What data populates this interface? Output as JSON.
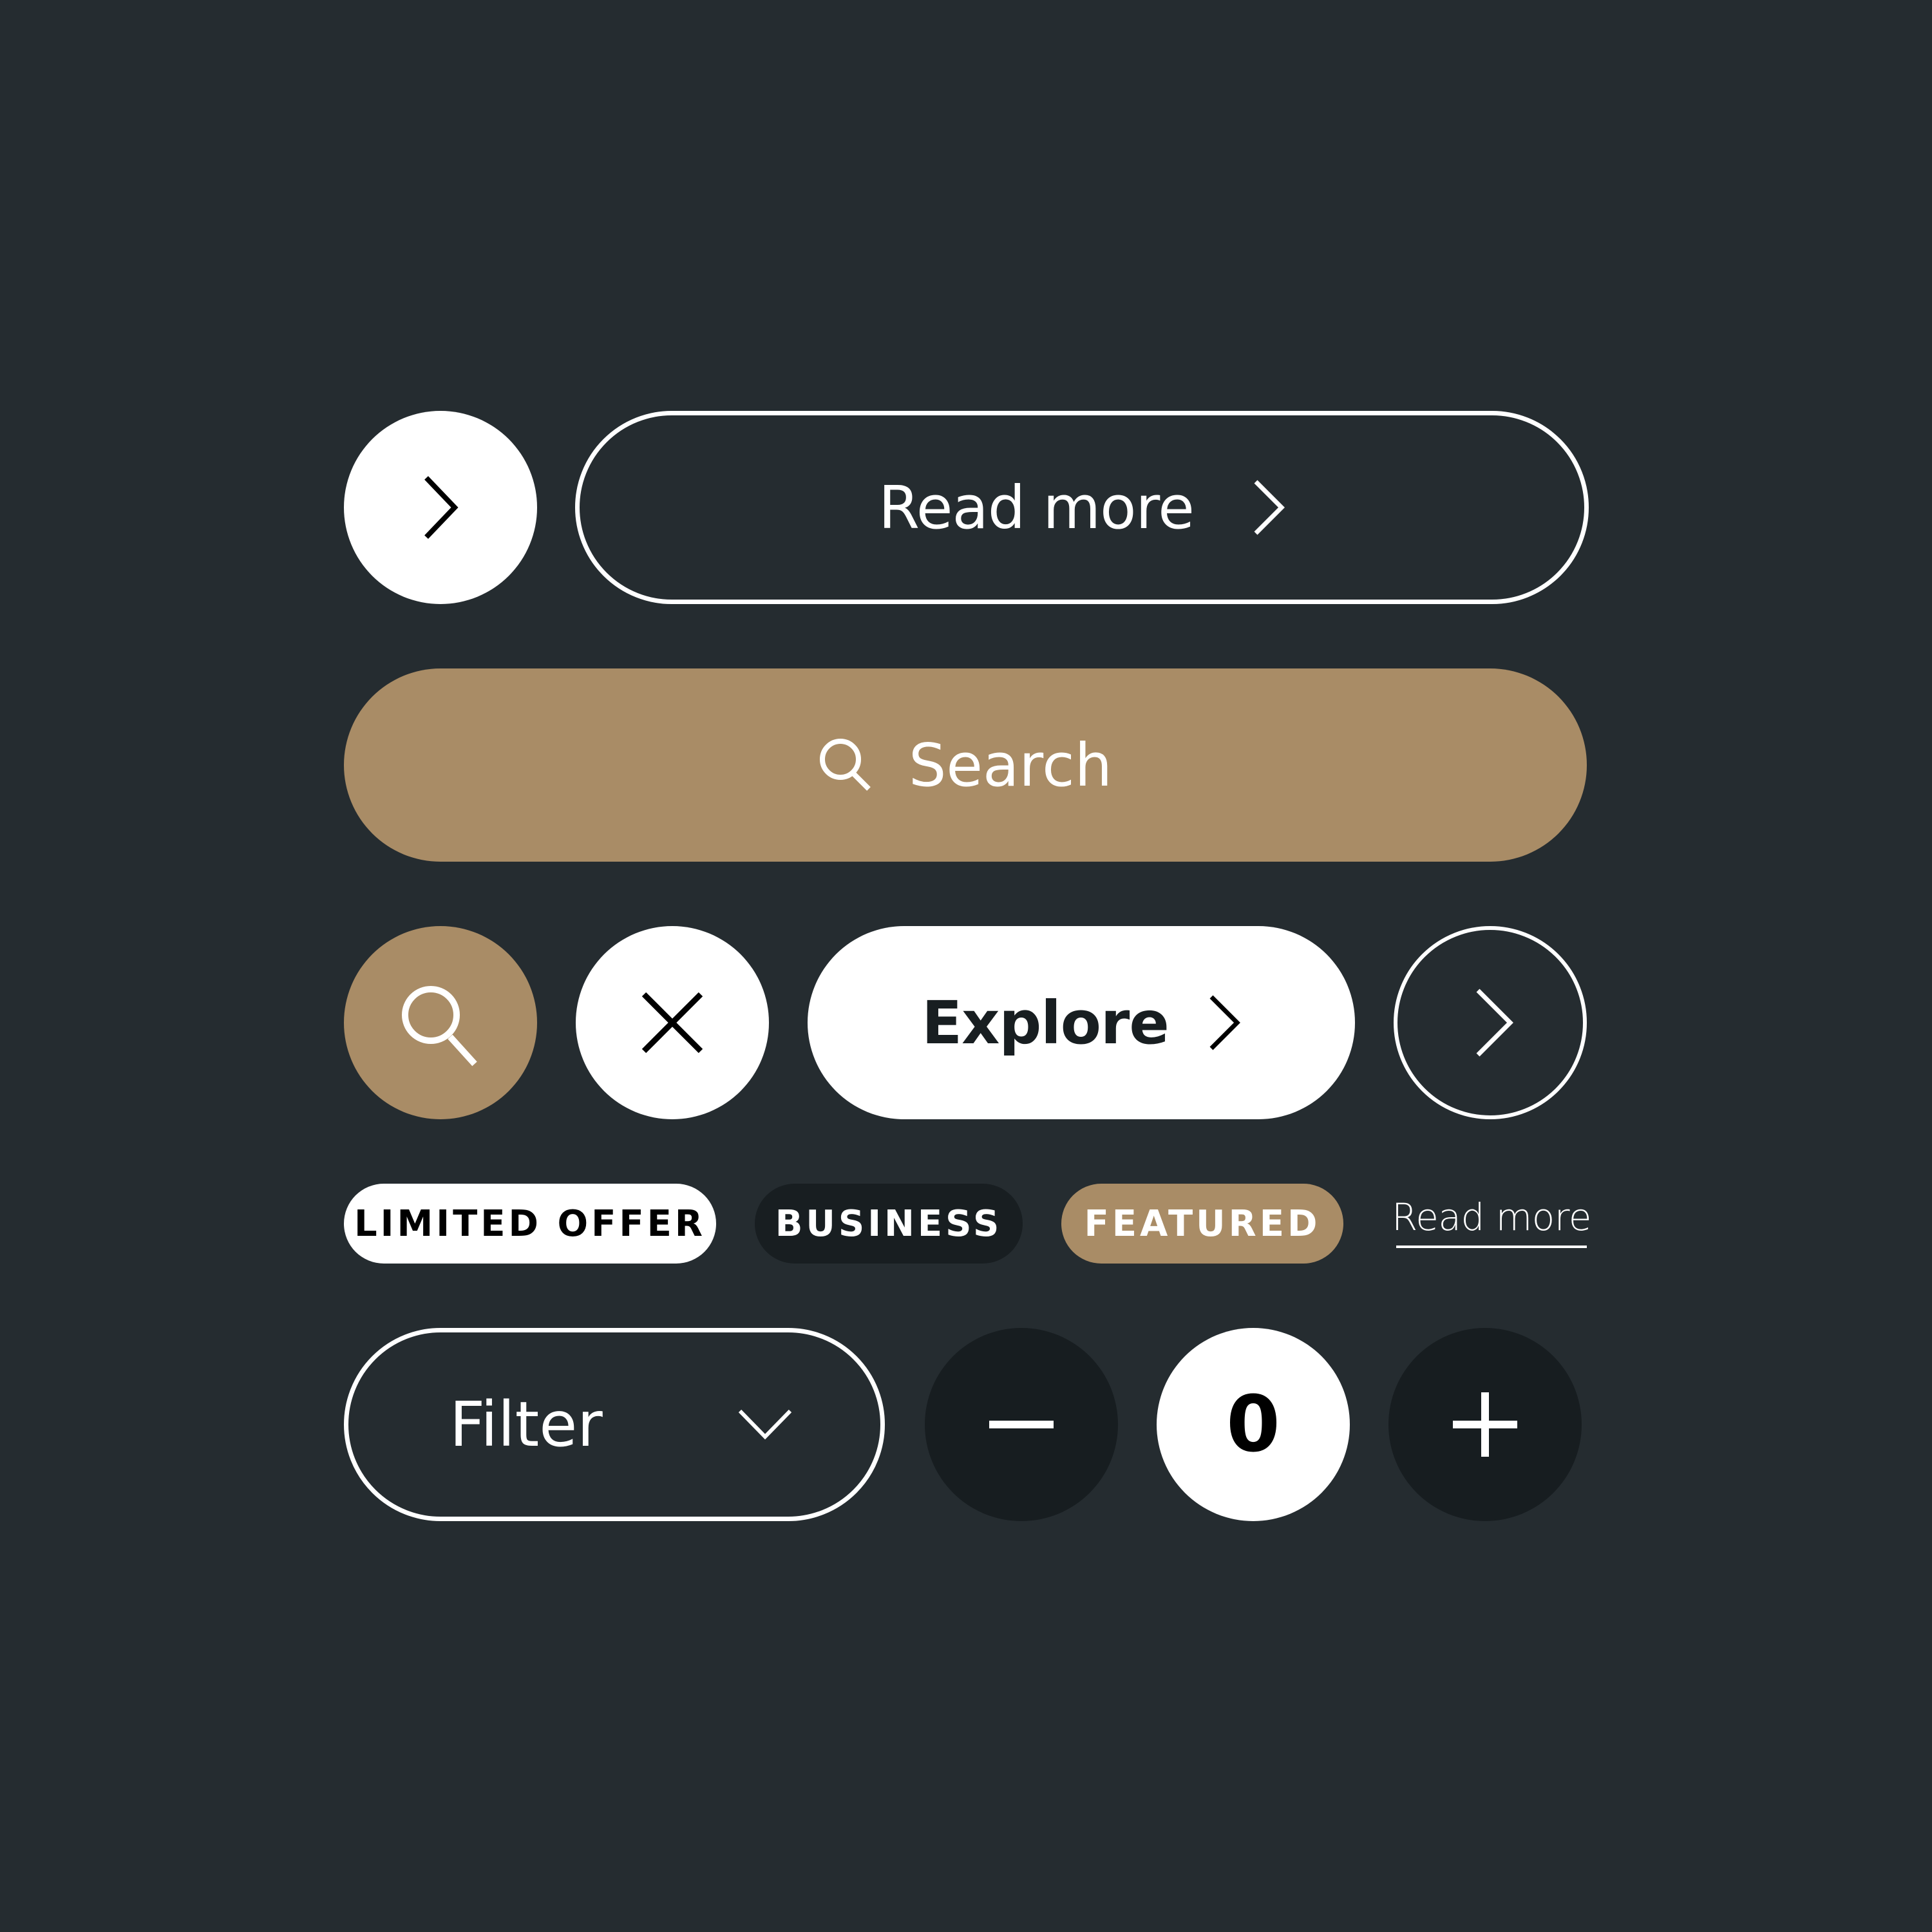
{
  "colors": {
    "background": "#252C30",
    "accent_gold": "#A98C66",
    "white": "#FFFFFF",
    "dark_chip": "#181E21",
    "stepper_dark": "#171D20"
  },
  "row1": {
    "next_button": {
      "icon": "chevron-right-icon"
    },
    "read_more_button": {
      "label": "Read more",
      "icon": "chevron-right-icon"
    }
  },
  "row2": {
    "search_button": {
      "label": "Search",
      "icon": "search-icon"
    }
  },
  "row3": {
    "search_icon_button": {
      "icon": "search-icon"
    },
    "close_button": {
      "icon": "close-icon"
    },
    "explore_button": {
      "label": "Explore",
      "icon": "chevron-right-icon"
    },
    "next_outline_button": {
      "icon": "chevron-right-icon"
    }
  },
  "row4": {
    "tags": [
      {
        "label": "LIMITED OFFER",
        "style": "white"
      },
      {
        "label": "BUSINESS",
        "style": "dark"
      },
      {
        "label": "FEATURED",
        "style": "gold"
      }
    ],
    "link": {
      "label": "Read more"
    }
  },
  "row5": {
    "filter": {
      "label": "Filter",
      "icon": "chevron-down-icon"
    },
    "stepper": {
      "value": "0",
      "decrement_icon": "minus-icon",
      "increment_icon": "plus-icon"
    }
  }
}
